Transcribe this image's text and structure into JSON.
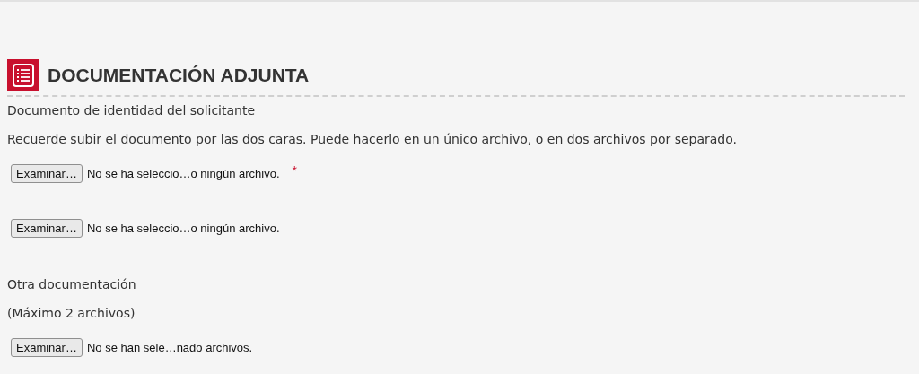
{
  "section": {
    "title": "DOCUMENTACIÓN ADJUNTA"
  },
  "items": [
    {
      "kind": "label",
      "text": "Documento de identidad del solicitante"
    },
    {
      "kind": "note",
      "text": "Recuerde subir el documento por las dos caras. Puede hacerlo en un único archivo, o en dos archivos por separado."
    },
    {
      "kind": "file",
      "button": "Examinar…",
      "status": "No se ha seleccio…o ningún archivo.",
      "marker": "*"
    },
    {
      "kind": "file",
      "button": "Examinar…",
      "status": "No se ha seleccio…o ningún archivo."
    },
    {
      "kind": "label",
      "text": "Otra documentación"
    },
    {
      "kind": "note",
      "text": "(Máximo 2 archivos)"
    },
    {
      "kind": "file",
      "button": "Examinar…",
      "status": "No se han sele…nado archivos."
    }
  ]
}
